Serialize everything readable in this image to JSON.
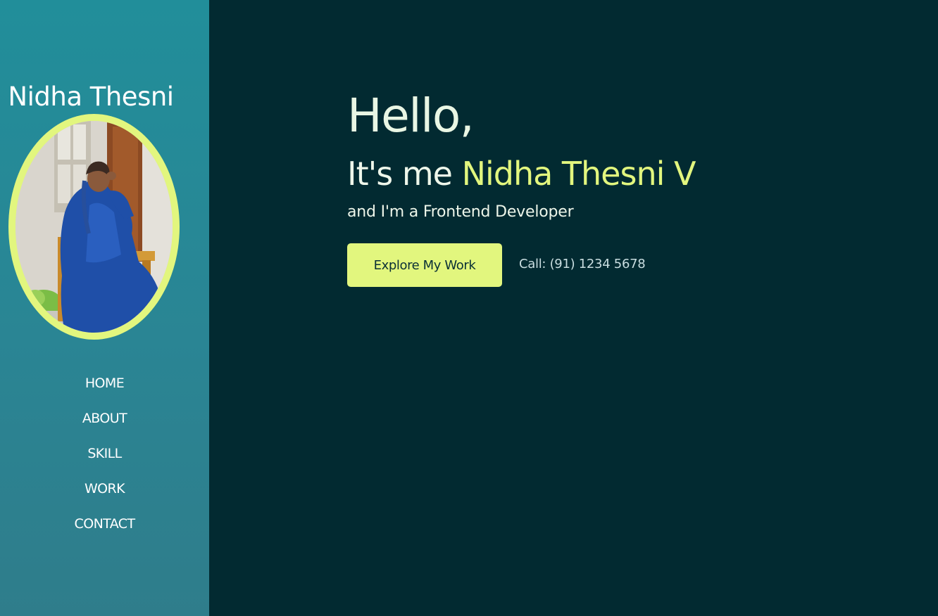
{
  "sidebar": {
    "brand": "Nidha Thesni",
    "avatar_alt": "profile-photo",
    "nav": [
      {
        "label": "HOME"
      },
      {
        "label": "ABOUT"
      },
      {
        "label": "SKILL"
      },
      {
        "label": "WORK"
      },
      {
        "label": "CONTACT"
      }
    ]
  },
  "hero": {
    "greeting": "Hello,",
    "intro_prefix": "It's me ",
    "name": "Nidha Thesni V",
    "role": "and I'm a Frontend Developer",
    "cta_label": "Explore My Work",
    "call_text": "Call: (91) 1234 5678"
  },
  "colors": {
    "sidebar": "#218e9a",
    "background": "#022a31",
    "accent": "#e2f67e",
    "text": "#eef6ea"
  }
}
